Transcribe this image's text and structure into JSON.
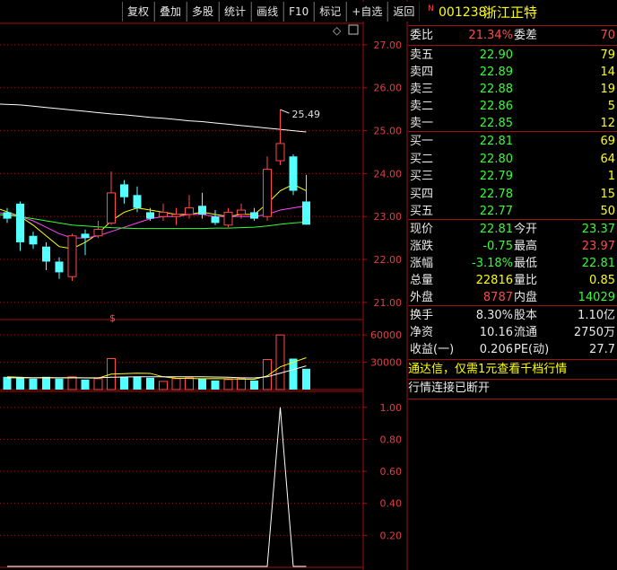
{
  "toolbar": {
    "items": [
      "复权",
      "叠加",
      "多股",
      "统计",
      "画线",
      "F10",
      "标记",
      "+自选",
      "返回"
    ]
  },
  "stock": {
    "code": "001238",
    "name": "浙江正特",
    "mark": "N"
  },
  "order": {
    "webi_label": "委比",
    "webi_value": "21.34%",
    "weicha_label": "委差",
    "weicha_value": "70"
  },
  "asks": [
    {
      "label": "卖五",
      "price": "22.90",
      "vol": "79"
    },
    {
      "label": "卖四",
      "price": "22.89",
      "vol": "14"
    },
    {
      "label": "卖三",
      "price": "22.88",
      "vol": "19"
    },
    {
      "label": "卖二",
      "price": "22.86",
      "vol": "5"
    },
    {
      "label": "卖一",
      "price": "22.85",
      "vol": "12"
    }
  ],
  "bids": [
    {
      "label": "买一",
      "price": "22.81",
      "vol": "69"
    },
    {
      "label": "买二",
      "price": "22.80",
      "vol": "64"
    },
    {
      "label": "买三",
      "price": "22.79",
      "vol": "1"
    },
    {
      "label": "买四",
      "price": "22.78",
      "vol": "15"
    },
    {
      "label": "买五",
      "price": "22.77",
      "vol": "50"
    }
  ],
  "quote": [
    {
      "l1": "现价",
      "v1": "22.81",
      "c1": "green",
      "l2": "今开",
      "v2": "23.37",
      "c2": "green"
    },
    {
      "l1": "涨跌",
      "v1": "-0.75",
      "c1": "green",
      "l2": "最高",
      "v2": "23.97",
      "c2": "red"
    },
    {
      "l1": "涨幅",
      "v1": "-3.18%",
      "c1": "green",
      "l2": "最低",
      "v2": "22.81",
      "c2": "green"
    },
    {
      "l1": "总量",
      "v1": "22816",
      "c1": "yellow",
      "l2": "量比",
      "v2": "0.85",
      "c2": "yellow"
    },
    {
      "l1": "外盘",
      "v1": "8787",
      "c1": "red",
      "l2": "内盘",
      "v2": "14029",
      "c2": "green"
    }
  ],
  "finance": [
    {
      "l1": "换手",
      "v1": "8.30%",
      "l2": "股本",
      "v2": "1.10亿"
    },
    {
      "l1": "净资",
      "v1": "10.16",
      "l2": "流通",
      "v2": "2750万"
    },
    {
      "l1": "收益(一)",
      "v1": "0.206",
      "l2": "PE(动)",
      "v2": "27.7"
    }
  ],
  "ad_text": "通达信，仅需1元查看千档行情",
  "status_text": "行情连接已断开",
  "colors": {
    "up": "#ff4a4a",
    "down": "#54ffff",
    "ma": "#ffffff",
    "grid": "#a01010"
  },
  "chart_data": [
    {
      "type": "candlestick",
      "ylim": [
        20.6,
        27.5
      ],
      "yticks": [
        "27.00",
        "26.00",
        "25.00",
        "24.00",
        "23.00",
        "22.00",
        "21.00"
      ],
      "annotation": "25.49",
      "candles": [
        {
          "o": 23.1,
          "c": 22.95,
          "h": 23.2,
          "l": 22.85,
          "up": false
        },
        {
          "o": 23.3,
          "c": 22.4,
          "h": 23.35,
          "l": 22.2,
          "up": false
        },
        {
          "o": 22.55,
          "c": 22.35,
          "h": 22.65,
          "l": 22.25,
          "up": false
        },
        {
          "o": 22.3,
          "c": 21.95,
          "h": 22.4,
          "l": 21.75,
          "up": false
        },
        {
          "o": 21.95,
          "c": 21.7,
          "h": 22.05,
          "l": 21.55,
          "up": false
        },
        {
          "o": 21.6,
          "c": 22.55,
          "h": 22.6,
          "l": 21.5,
          "up": true
        },
        {
          "o": 22.5,
          "c": 22.6,
          "h": 22.7,
          "l": 22.1,
          "up": false
        },
        {
          "o": 22.55,
          "c": 22.7,
          "h": 22.9,
          "l": 22.5,
          "up": true
        },
        {
          "o": 22.85,
          "c": 23.55,
          "h": 24.05,
          "l": 22.8,
          "up": true
        },
        {
          "o": 23.75,
          "c": 23.45,
          "h": 23.85,
          "l": 23.3,
          "up": false
        },
        {
          "o": 23.5,
          "c": 23.2,
          "h": 23.7,
          "l": 23.1,
          "up": false
        },
        {
          "o": 23.1,
          "c": 22.95,
          "h": 23.2,
          "l": 22.9,
          "up": false
        },
        {
          "o": 23.0,
          "c": 23.1,
          "h": 23.3,
          "l": 22.9,
          "up": true
        },
        {
          "o": 23.0,
          "c": 23.05,
          "h": 23.2,
          "l": 22.8,
          "up": true
        },
        {
          "o": 23.05,
          "c": 23.2,
          "h": 23.5,
          "l": 22.95,
          "up": true
        },
        {
          "o": 23.25,
          "c": 23.05,
          "h": 23.55,
          "l": 22.95,
          "up": false
        },
        {
          "o": 23.0,
          "c": 22.85,
          "h": 23.15,
          "l": 22.8,
          "up": false
        },
        {
          "o": 22.8,
          "c": 23.1,
          "h": 23.2,
          "l": 22.75,
          "up": true
        },
        {
          "o": 23.05,
          "c": 23.15,
          "h": 23.3,
          "l": 22.95,
          "up": true
        },
        {
          "o": 23.1,
          "c": 22.95,
          "h": 23.2,
          "l": 22.9,
          "up": false
        },
        {
          "o": 23.0,
          "c": 24.1,
          "h": 24.4,
          "l": 22.9,
          "up": true
        },
        {
          "o": 24.3,
          "c": 24.7,
          "h": 25.49,
          "l": 24.2,
          "up": true
        },
        {
          "o": 24.4,
          "c": 23.6,
          "h": 24.45,
          "l": 23.5,
          "up": false
        },
        {
          "o": 23.35,
          "c": 22.81,
          "h": 23.97,
          "l": 22.81,
          "up": false
        }
      ],
      "ma_series": [
        {
          "color": "#ffffff",
          "values": [
            25.62,
            25.6,
            25.57,
            25.54,
            25.51,
            25.48,
            25.45,
            25.42,
            25.39,
            25.37,
            25.34,
            25.31,
            25.29,
            25.26,
            25.23,
            25.21,
            25.18,
            25.15,
            25.12,
            25.09,
            25.06,
            25.03,
            25.0,
            24.97
          ]
        },
        {
          "color": "#ffff00",
          "values": [
            23.2,
            23.0,
            22.8,
            22.55,
            22.3,
            22.25,
            22.4,
            22.6,
            22.9,
            23.1,
            23.2,
            23.15,
            23.1,
            23.05,
            23.05,
            23.1,
            23.05,
            23.0,
            23.05,
            23.05,
            23.3,
            23.6,
            23.75,
            23.6
          ]
        },
        {
          "color": "#ff44ff",
          "values": [
            23.1,
            23.0,
            22.9,
            22.75,
            22.6,
            22.5,
            22.5,
            22.55,
            22.65,
            22.75,
            22.85,
            22.95,
            23.0,
            23.0,
            23.05,
            23.05,
            23.0,
            23.0,
            23.0,
            23.0,
            23.05,
            23.15,
            23.2,
            23.25
          ]
        },
        {
          "color": "#33ff33",
          "values": [
            23.05,
            23.0,
            22.95,
            22.9,
            22.85,
            22.8,
            22.78,
            22.76,
            22.74,
            22.73,
            22.72,
            22.72,
            22.72,
            22.72,
            22.72,
            22.72,
            22.73,
            22.73,
            22.74,
            22.75,
            22.78,
            22.82,
            22.85,
            22.87
          ]
        }
      ]
    },
    {
      "type": "bar",
      "ylim": [
        0,
        70000
      ],
      "yticks": [
        "60000",
        "30000"
      ],
      "values": [
        14000,
        13000,
        12000,
        14000,
        12000,
        14000,
        11000,
        12000,
        34000,
        14000,
        14000,
        13000,
        9000,
        12000,
        13000,
        12000,
        10000,
        11000,
        12000,
        10000,
        33000,
        60000,
        34000,
        22816
      ],
      "up": [
        false,
        false,
        false,
        false,
        false,
        true,
        false,
        true,
        true,
        false,
        false,
        false,
        true,
        true,
        true,
        false,
        false,
        true,
        true,
        false,
        true,
        true,
        false,
        false
      ],
      "ma_series": [
        {
          "color": "#ffff00",
          "values": [
            14000,
            13500,
            13000,
            13200,
            13000,
            13100,
            12800,
            12600,
            17000,
            17500,
            18000,
            17800,
            14000,
            12500,
            12200,
            12000,
            12100,
            11800,
            11500,
            11300,
            15000,
            25000,
            30000,
            35000
          ]
        },
        {
          "color": "#ffffff",
          "values": [
            13000,
            13000,
            13000,
            13000,
            13000,
            13000,
            13000,
            13000,
            13500,
            13800,
            14000,
            14000,
            14000,
            14000,
            14000,
            14000,
            13800,
            13500,
            13000,
            12800,
            14000,
            18000,
            22000,
            26000
          ]
        }
      ]
    },
    {
      "type": "line",
      "ylim": [
        0,
        1.1
      ],
      "yticks": [
        "1.00",
        "0.80",
        "0.60",
        "0.40",
        "0.20"
      ],
      "values": [
        0,
        0,
        0,
        0,
        0,
        0,
        0,
        0,
        0,
        0,
        0,
        0,
        0,
        0,
        0,
        0,
        0,
        0,
        0,
        0,
        0,
        1,
        0,
        0
      ]
    }
  ]
}
